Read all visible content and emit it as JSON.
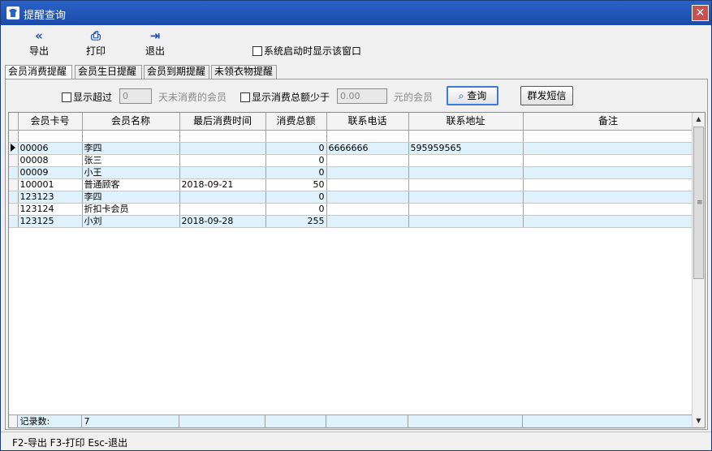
{
  "window": {
    "title": "提醒查询",
    "close": "✕"
  },
  "toolbar": {
    "export_label": "导出",
    "print_label": "打印",
    "exit_label": "退出",
    "startup_checkbox_label": "系统启动时显示该窗口",
    "startup_checked": false
  },
  "tabs": [
    {
      "label": "会员消费提醒",
      "active": true
    },
    {
      "label": "会员生日提醒",
      "active": false
    },
    {
      "label": "会员到期提醒",
      "active": false
    },
    {
      "label": "未领衣物提醒",
      "active": false
    }
  ],
  "filter": {
    "days_checkbox_label": "显示超过",
    "days_value": "0",
    "days_suffix": "天未消费的会员",
    "total_checkbox_label": "显示消费总额少于",
    "total_value": "0.00",
    "total_suffix": "元的会员",
    "query_label": "查询",
    "sms_label": "群发短信"
  },
  "table": {
    "columns": [
      "会员卡号",
      "会员名称",
      "最后消费时间",
      "消费总额",
      "联系电话",
      "联系地址",
      "备注"
    ],
    "rows": [
      {
        "card": "00006",
        "name": "李四",
        "last": "",
        "total": "0",
        "phone": "6666666",
        "address": "595959565",
        "note": "",
        "current": true
      },
      {
        "card": "00008",
        "name": "张三",
        "last": "",
        "total": "0",
        "phone": "",
        "address": "",
        "note": ""
      },
      {
        "card": "00009",
        "name": "小王",
        "last": "",
        "total": "0",
        "phone": "",
        "address": "",
        "note": ""
      },
      {
        "card": "100001",
        "name": "普通顾客",
        "last": "2018-09-21",
        "total": "50",
        "phone": "",
        "address": "",
        "note": ""
      },
      {
        "card": "123123",
        "name": "李四",
        "last": "",
        "total": "0",
        "phone": "",
        "address": "",
        "note": ""
      },
      {
        "card": "123124",
        "name": "折扣卡会员",
        "last": "",
        "total": "0",
        "phone": "",
        "address": "",
        "note": ""
      },
      {
        "card": "123125",
        "name": "小刘",
        "last": "2018-09-28",
        "total": "255",
        "phone": "",
        "address": "",
        "note": ""
      }
    ],
    "footer_label": "记录数:",
    "footer_count": "7"
  },
  "status_bar": "F2-导出 F3-打印 Esc-退出",
  "colors": {
    "title_bar": "#1b4ba8",
    "alt_row": "#dff2fb"
  }
}
